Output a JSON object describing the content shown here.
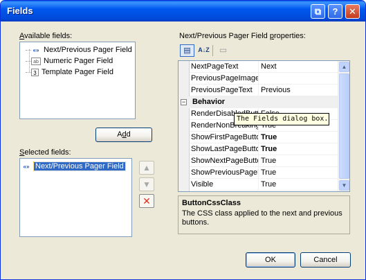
{
  "window": {
    "title": "Fields"
  },
  "titlebar_buttons": {
    "restore_glyph": "⧉",
    "help_glyph": "?",
    "close_glyph": "✕"
  },
  "available_fields": {
    "label_prefix": "",
    "label_underlined": "A",
    "label_rest": "vailable fields:",
    "items": [
      {
        "icon": "«»",
        "label": "Next/Previous Pager Field"
      },
      {
        "icon": "ab",
        "label": "Numeric Pager Field"
      },
      {
        "icon": "3",
        "label": "Template Pager Field"
      }
    ]
  },
  "add_button": {
    "pre": "A",
    "underlined": "d",
    "post": "d"
  },
  "selected_fields": {
    "label_underlined": "S",
    "label_rest": "elected fields:",
    "items": [
      {
        "icon": "«»",
        "label": "Next/Previous Pager Field"
      }
    ]
  },
  "side_buttons": {
    "up": "▲",
    "down": "▼",
    "delete": "✕"
  },
  "properties": {
    "label_pre": "Next/Previous Pager Field ",
    "label_underlined": "p",
    "label_post": "roperties:",
    "toolbar": {
      "categorized": "▤",
      "alphabetical": "A↓Z",
      "pages": "▭"
    },
    "rows_top": [
      {
        "name": "NextPageText",
        "value": "Next",
        "bold": false
      },
      {
        "name": "PreviousPageImage",
        "value": "",
        "bold": false
      },
      {
        "name": "PreviousPageText",
        "value": "Previous",
        "bold": false
      }
    ],
    "category": {
      "toggle": "−",
      "name": "Behavior"
    },
    "rows_bottom": [
      {
        "name": "RenderDisabledButtonsAsLabels",
        "value": "False",
        "bold": false
      },
      {
        "name": "RenderNonBreakingSpacesBetweenControls",
        "value": "True",
        "bold": false
      },
      {
        "name": "ShowFirstPageButton",
        "value": "True",
        "bold": true
      },
      {
        "name": "ShowLastPageButton",
        "value": "True",
        "bold": true
      },
      {
        "name": "ShowNextPageButton",
        "value": "True",
        "bold": false
      },
      {
        "name": "ShowPreviousPageButton",
        "value": "True",
        "bold": false
      },
      {
        "name": "Visible",
        "value": "True",
        "bold": false
      }
    ],
    "scroll_up": "▲",
    "scroll_down": "▼"
  },
  "tooltip": "The Fields dialog box.",
  "description": {
    "title": "ButtonCssClass",
    "text": "The CSS class applied to the next and previous buttons."
  },
  "ok_button": "OK",
  "cancel_button": "Cancel"
}
